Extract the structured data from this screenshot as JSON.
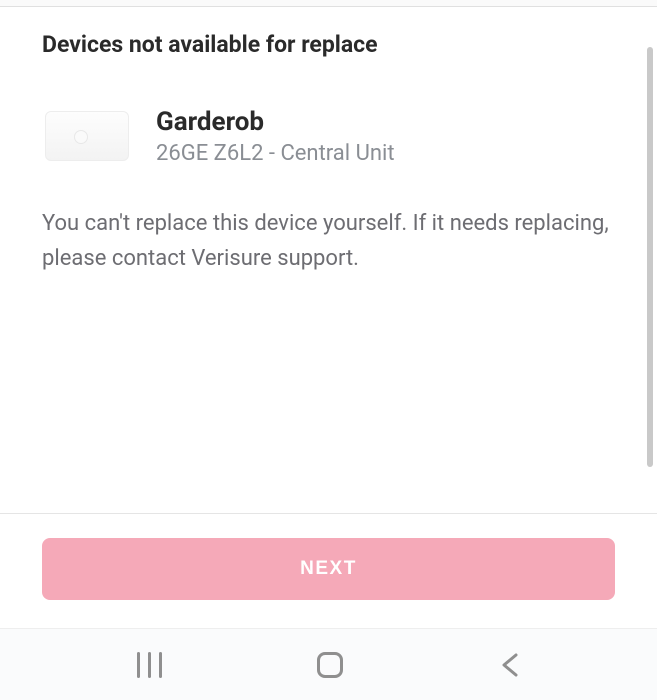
{
  "header": {
    "title": "Devices not available for replace"
  },
  "device": {
    "name": "Garderob",
    "serial": "26GE Z6L2",
    "type": "Central Unit"
  },
  "message": "You can't replace this device yourself. If it needs replacing, please contact Verisure support.",
  "buttons": {
    "next_label": "NEXT"
  }
}
